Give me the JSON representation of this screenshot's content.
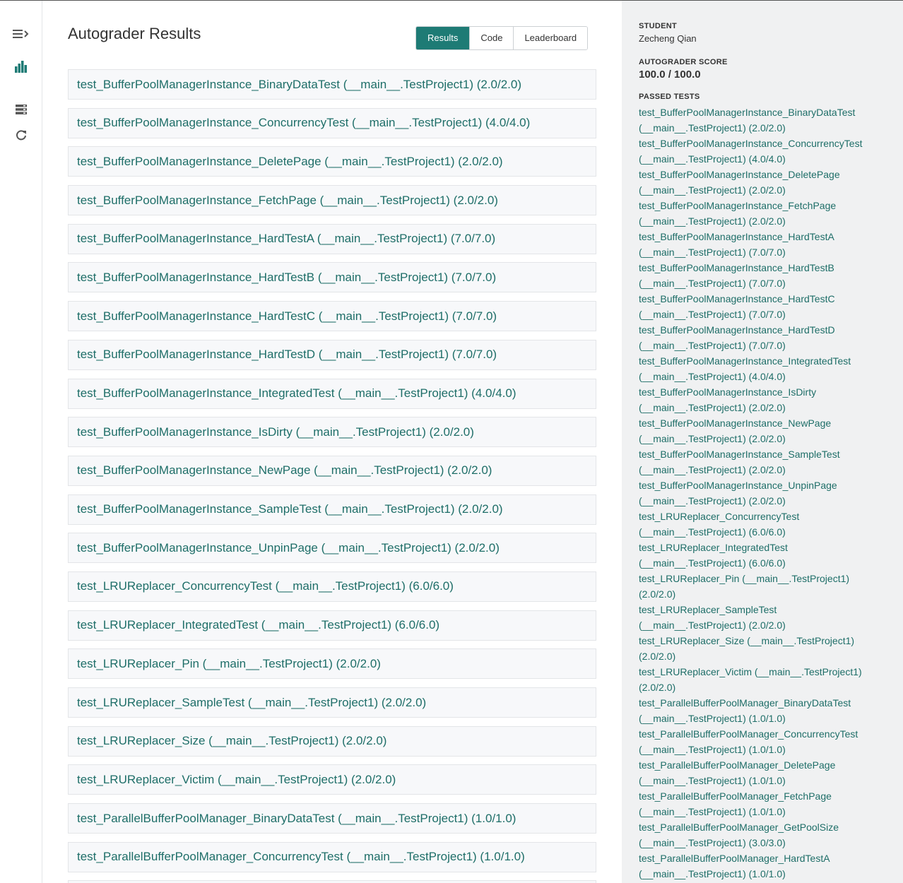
{
  "nav": {
    "icons": [
      "menu-expand-icon",
      "bar-chart-icon",
      "list-icon",
      "refresh-icon"
    ],
    "accent": "#1e7b75"
  },
  "main": {
    "title": "Autograder Results",
    "tabs": [
      {
        "label": "Results",
        "active": true
      },
      {
        "label": "Code",
        "active": false
      },
      {
        "label": "Leaderboard",
        "active": false
      }
    ],
    "tests": [
      "test_BufferPoolManagerInstance_BinaryDataTest (__main__.TestProject1) (2.0/2.0)",
      "test_BufferPoolManagerInstance_ConcurrencyTest (__main__.TestProject1) (4.0/4.0)",
      "test_BufferPoolManagerInstance_DeletePage (__main__.TestProject1) (2.0/2.0)",
      "test_BufferPoolManagerInstance_FetchPage (__main__.TestProject1) (2.0/2.0)",
      "test_BufferPoolManagerInstance_HardTestA (__main__.TestProject1) (7.0/7.0)",
      "test_BufferPoolManagerInstance_HardTestB (__main__.TestProject1) (7.0/7.0)",
      "test_BufferPoolManagerInstance_HardTestC (__main__.TestProject1) (7.0/7.0)",
      "test_BufferPoolManagerInstance_HardTestD (__main__.TestProject1) (7.0/7.0)",
      "test_BufferPoolManagerInstance_IntegratedTest (__main__.TestProject1) (4.0/4.0)",
      "test_BufferPoolManagerInstance_IsDirty (__main__.TestProject1) (2.0/2.0)",
      "test_BufferPoolManagerInstance_NewPage (__main__.TestProject1) (2.0/2.0)",
      "test_BufferPoolManagerInstance_SampleTest (__main__.TestProject1) (2.0/2.0)",
      "test_BufferPoolManagerInstance_UnpinPage (__main__.TestProject1) (2.0/2.0)",
      "test_LRUReplacer_ConcurrencyTest (__main__.TestProject1) (6.0/6.0)",
      "test_LRUReplacer_IntegratedTest (__main__.TestProject1) (6.0/6.0)",
      "test_LRUReplacer_Pin (__main__.TestProject1) (2.0/2.0)",
      "test_LRUReplacer_SampleTest (__main__.TestProject1) (2.0/2.0)",
      "test_LRUReplacer_Size (__main__.TestProject1) (2.0/2.0)",
      "test_LRUReplacer_Victim (__main__.TestProject1) (2.0/2.0)",
      "test_ParallelBufferPoolManager_BinaryDataTest (__main__.TestProject1) (1.0/1.0)",
      "test_ParallelBufferPoolManager_ConcurrencyTest (__main__.TestProject1) (1.0/1.0)",
      ""
    ]
  },
  "sidebar": {
    "student_label": "STUDENT",
    "student_name": "Zecheng Qian",
    "score_label": "AUTOGRADER SCORE",
    "score_value": "100.0 / 100.0",
    "passed_label": "PASSED TESTS",
    "passed_lines": [
      "test_BufferPoolManagerInstance_BinaryDataTest",
      "(__main__.TestProject1) (2.0/2.0)",
      "test_BufferPoolManagerInstance_ConcurrencyTest",
      "(__main__.TestProject1) (4.0/4.0)",
      "test_BufferPoolManagerInstance_DeletePage",
      "(__main__.TestProject1) (2.0/2.0)",
      "test_BufferPoolManagerInstance_FetchPage",
      "(__main__.TestProject1) (2.0/2.0)",
      "test_BufferPoolManagerInstance_HardTestA",
      "(__main__.TestProject1) (7.0/7.0)",
      "test_BufferPoolManagerInstance_HardTestB",
      "(__main__.TestProject1) (7.0/7.0)",
      "test_BufferPoolManagerInstance_HardTestC",
      "(__main__.TestProject1) (7.0/7.0)",
      "test_BufferPoolManagerInstance_HardTestD",
      "(__main__.TestProject1) (7.0/7.0)",
      "test_BufferPoolManagerInstance_IntegratedTest",
      "(__main__.TestProject1) (4.0/4.0)",
      "test_BufferPoolManagerInstance_IsDirty",
      "(__main__.TestProject1) (2.0/2.0)",
      "test_BufferPoolManagerInstance_NewPage",
      "(__main__.TestProject1) (2.0/2.0)",
      "test_BufferPoolManagerInstance_SampleTest",
      "(__main__.TestProject1) (2.0/2.0)",
      "test_BufferPoolManagerInstance_UnpinPage",
      "(__main__.TestProject1) (2.0/2.0)",
      "test_LRUReplacer_ConcurrencyTest",
      "(__main__.TestProject1) (6.0/6.0)",
      "test_LRUReplacer_IntegratedTest",
      "(__main__.TestProject1) (6.0/6.0)",
      "test_LRUReplacer_Pin (__main__.TestProject1)",
      "(2.0/2.0)",
      "test_LRUReplacer_SampleTest",
      "(__main__.TestProject1) (2.0/2.0)",
      "test_LRUReplacer_Size (__main__.TestProject1)",
      "(2.0/2.0)",
      "test_LRUReplacer_Victim (__main__.TestProject1)",
      "(2.0/2.0)",
      "test_ParallelBufferPoolManager_BinaryDataTest",
      "(__main__.TestProject1) (1.0/1.0)",
      "test_ParallelBufferPoolManager_ConcurrencyTest",
      "(__main__.TestProject1) (1.0/1.0)",
      "test_ParallelBufferPoolManager_DeletePage",
      "(__main__.TestProject1) (1.0/1.0)",
      "test_ParallelBufferPoolManager_FetchPage",
      "(__main__.TestProject1) (1.0/1.0)",
      "test_ParallelBufferPoolManager_GetPoolSize",
      "(__main__.TestProject1) (3.0/3.0)",
      "test_ParallelBufferPoolManager_HardTestA",
      "(__main__.TestProject1) (1.0/1.0)"
    ]
  }
}
